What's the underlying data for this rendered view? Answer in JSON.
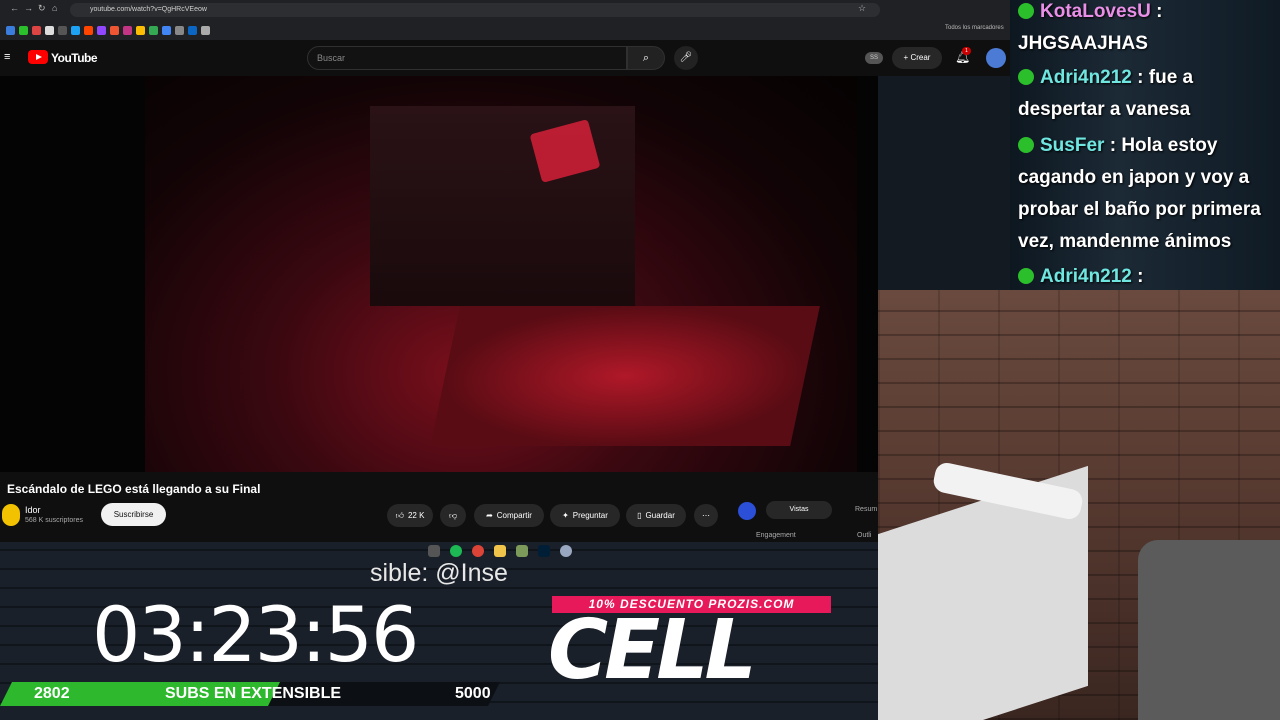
{
  "browser": {
    "url": "youtube.com/watch?v=QgHRcVEeow",
    "bookmarks_label": "Todos los marcadores"
  },
  "youtube": {
    "logo_text": "YouTube",
    "search_placeholder": "Buscar",
    "ss_badge": "SS",
    "create_label": "Crear",
    "notif_count": "1",
    "video_title": "Escándalo de LEGO está llegando a su Final",
    "channel_name": "Idor",
    "channel_subs": "568 K suscriptores",
    "subscribe_label": "Suscribirse",
    "likes": "22 K",
    "share_label": "Compartir",
    "ask_label": "Preguntar",
    "save_label": "Guardar",
    "panel_tab_vistas": "Vistas",
    "panel_tab_resumen": "Resum",
    "panel_engagement": "Engagement",
    "panel_outliers": "Outli"
  },
  "stream": {
    "credit_text": "sible: @Inse",
    "timer": "03:23:56",
    "subs_count": "2802",
    "subs_label": "SUBS EN EXTENSIBLE",
    "subs_goal": "5000",
    "subs_progress": 0.56,
    "promo_text": "10% DESCUENTO PROZIS.COM",
    "brand": "CELL"
  },
  "chat": [
    {
      "user": "KotaLovesU",
      "text": "JHGSAAJHAS"
    },
    {
      "user": "Adri4n212",
      "text": "fue a despertar a vanesa"
    },
    {
      "user": "SusFer",
      "text": "Hola estoy cagando en japon y voy a probar el baño por primera vez, mandenme ánimos"
    },
    {
      "user": "Adri4n212",
      "text": ""
    }
  ],
  "colors": {
    "yt_red": "#ff0000",
    "progress_green": "#2db82d",
    "promo_pink": "#e8195a",
    "chat_user_pink": "#e98fe8",
    "chat_user_cyan": "#6fe6e0"
  }
}
